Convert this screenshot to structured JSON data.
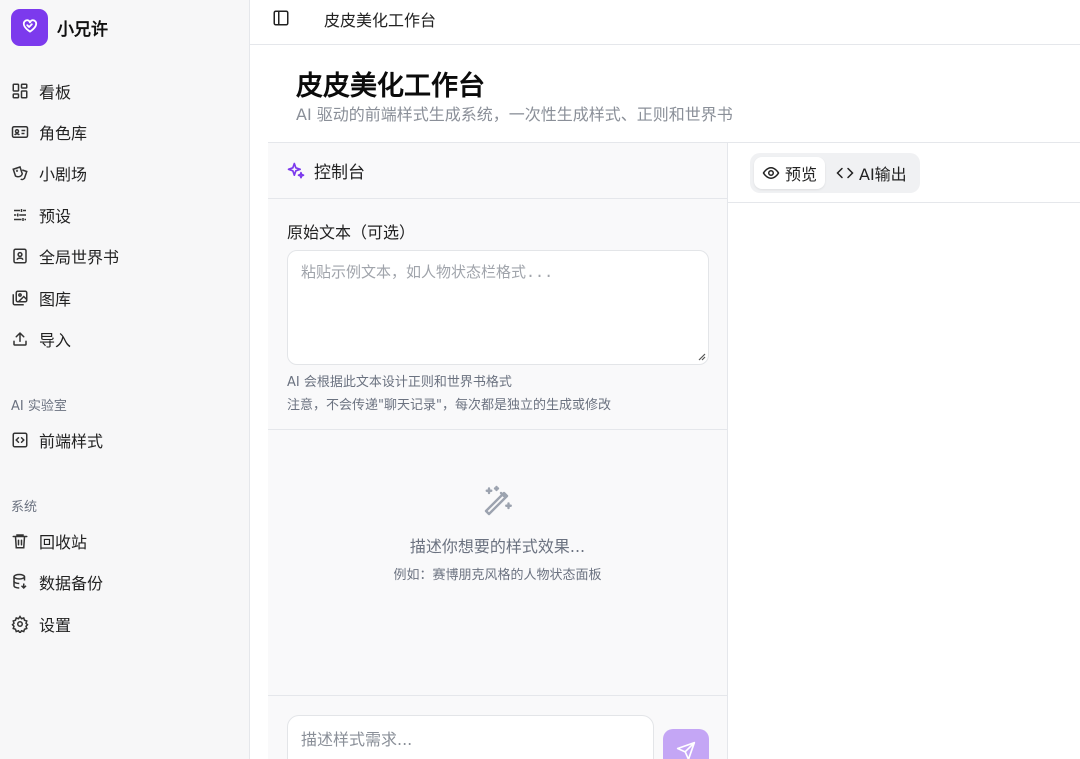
{
  "brand": {
    "name": "小兄许"
  },
  "sidebar": {
    "items": [
      {
        "label": "看板",
        "icon": "dashboard-icon"
      },
      {
        "label": "角色库",
        "icon": "id-card-icon"
      },
      {
        "label": "小剧场",
        "icon": "theater-masks-icon"
      },
      {
        "label": "预设",
        "icon": "sliders-icon"
      },
      {
        "label": "全局世界书",
        "icon": "book-user-icon"
      },
      {
        "label": "图库",
        "icon": "images-icon"
      },
      {
        "label": "导入",
        "icon": "upload-icon"
      }
    ],
    "lab_section": "AI 实验室",
    "lab_items": [
      {
        "label": "前端样式",
        "icon": "code-square-icon"
      }
    ],
    "system_section": "系统",
    "system_items": [
      {
        "label": "回收站",
        "icon": "trash-icon"
      },
      {
        "label": "数据备份",
        "icon": "database-icon"
      },
      {
        "label": "设置",
        "icon": "gear-icon"
      }
    ]
  },
  "topbar": {
    "breadcrumb": "皮皮美化工作台"
  },
  "header": {
    "title": "皮皮美化工作台",
    "subtitle": "AI 驱动的前端样式生成系统，一次性生成样式、正则和世界书"
  },
  "control_panel": {
    "title": "控制台",
    "source_label": "原始文本（可选）",
    "source_placeholder": "粘贴示例文本，如人物状态栏格式...",
    "hint1": "AI 会根据此文本设计正则和世界书格式",
    "hint2": "注意，不会传递\"聊天记录\"，每次都是独立的生成或修改",
    "empty_title": "描述你想要的样式效果...",
    "empty_example": "例如：赛博朋克风格的人物状态面板",
    "prompt_placeholder": "描述样式需求..."
  },
  "output_tabs": [
    {
      "label": "预览",
      "icon": "eye-icon",
      "active": true
    },
    {
      "label": "AI输出",
      "icon": "code-icon",
      "active": false
    }
  ],
  "colors": {
    "accent": "#7c3aed",
    "send_button": "#c4a6f5"
  }
}
